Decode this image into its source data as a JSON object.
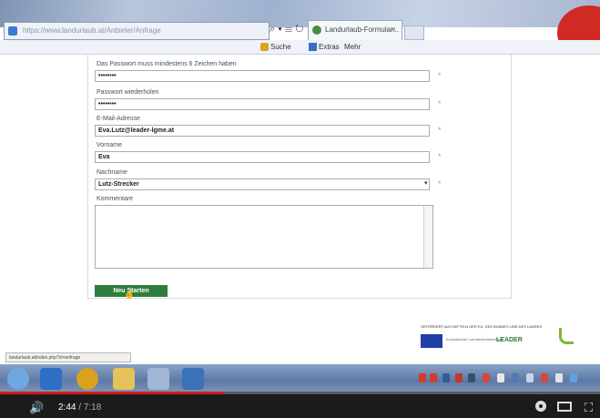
{
  "browser": {
    "address_text": "https://www.landurlaub.at/Anbieter/Anfrage",
    "tab_title": "Landurlaub-Formular...",
    "toolbar": {
      "suche": "Suche",
      "tools": "Extras",
      "more": "Mehr"
    },
    "status_url": "landurlaub.at/index.php?cl=anfrage"
  },
  "form": {
    "password_hint_label": "Das Passwort muss mindestens 6 Zeichen haben",
    "password_value": "••••••••",
    "password_repeat_label": "Passwort wiederholen",
    "password_repeat_value": "••••••••",
    "email_label": "E-Mail-Adresse",
    "email_value": "Eva.Lutz@leader-lgme.at",
    "firstname_label": "Vorname",
    "firstname_value": "Eva",
    "lastname_label": "Nachname",
    "lastname_value": "Lutz-Strecker",
    "comments_label": "Kommentare",
    "required_mark": "*",
    "submit_label": "Neu Starten"
  },
  "footer": {
    "funding_text": "GEFÖRDERT AUS MITTELN DER EU, DES BUNDES UND DES LANDES",
    "eu_text": "Europäischer Landwirtschaftsfonds",
    "leader_text": "LEADER"
  },
  "player": {
    "current_time": "2:44",
    "duration": "7:18",
    "progress": 0.374
  },
  "colors": {
    "submit": "#2e7d3c",
    "progress": "#cc1b1b"
  }
}
